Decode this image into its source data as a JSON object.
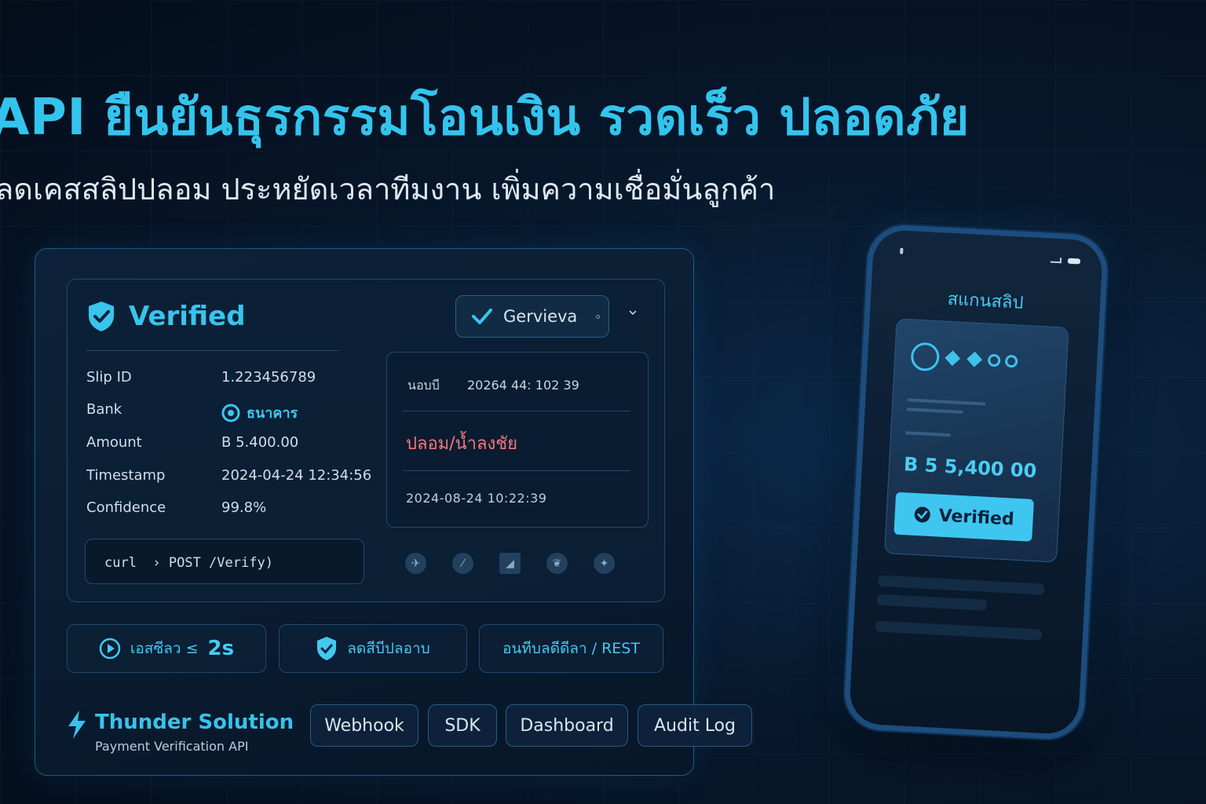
{
  "headline": "API ยืนยันธุรกรรมโอนเงิน รวดเร็ว ปลอดภัย",
  "subheadline": "ลดเคสสลิปปลอม ประหยัดเวลาทีมงาน เพิ่มความเชื่อมั่นลูกค้า",
  "card": {
    "status_label": "Verified",
    "account_button": "Gervieva",
    "fields": [
      {
        "label": "Slip ID",
        "value": "1.223456789"
      },
      {
        "label": "Bank",
        "value": "ธนาคาร"
      },
      {
        "label": "Amount",
        "value": "B 5.400.00"
      },
      {
        "label": "Timestamp",
        "value": "2024-04-24 12:34:56"
      },
      {
        "label": "Confidence",
        "value": "99.8%"
      }
    ],
    "curl": "curl  › POST /Verify)",
    "detail": {
      "label": "นอบบี",
      "value": "20264 44: 102 39",
      "warning": "ปลอม/น้ำลงชัย",
      "timestamp": "2024-08-24 10:22:39"
    },
    "bank_logos": [
      "bank-logo-1",
      "bank-logo-2",
      "bank-logo-3",
      "bank-logo-4",
      "bank-logo-5"
    ]
  },
  "features": [
    {
      "label": "เอสซีลว ≤",
      "value": "2s"
    },
    {
      "label": "ลดสีบีปลอาบ"
    },
    {
      "label": "อนทีบลดีดีลา / REST"
    }
  ],
  "brand": {
    "name": "Thunder Solution",
    "tagline": "Payment Verification API"
  },
  "chips": [
    "Webhook",
    "SDK",
    "Dashboard",
    "Audit Log"
  ],
  "phone": {
    "title": "สแกนสลิป",
    "amount": "B 5 5,400 00",
    "verified_label": "Verified"
  },
  "colors": {
    "accent": "#33c4ee",
    "warning": "#f2787a",
    "background": "#07182c"
  }
}
